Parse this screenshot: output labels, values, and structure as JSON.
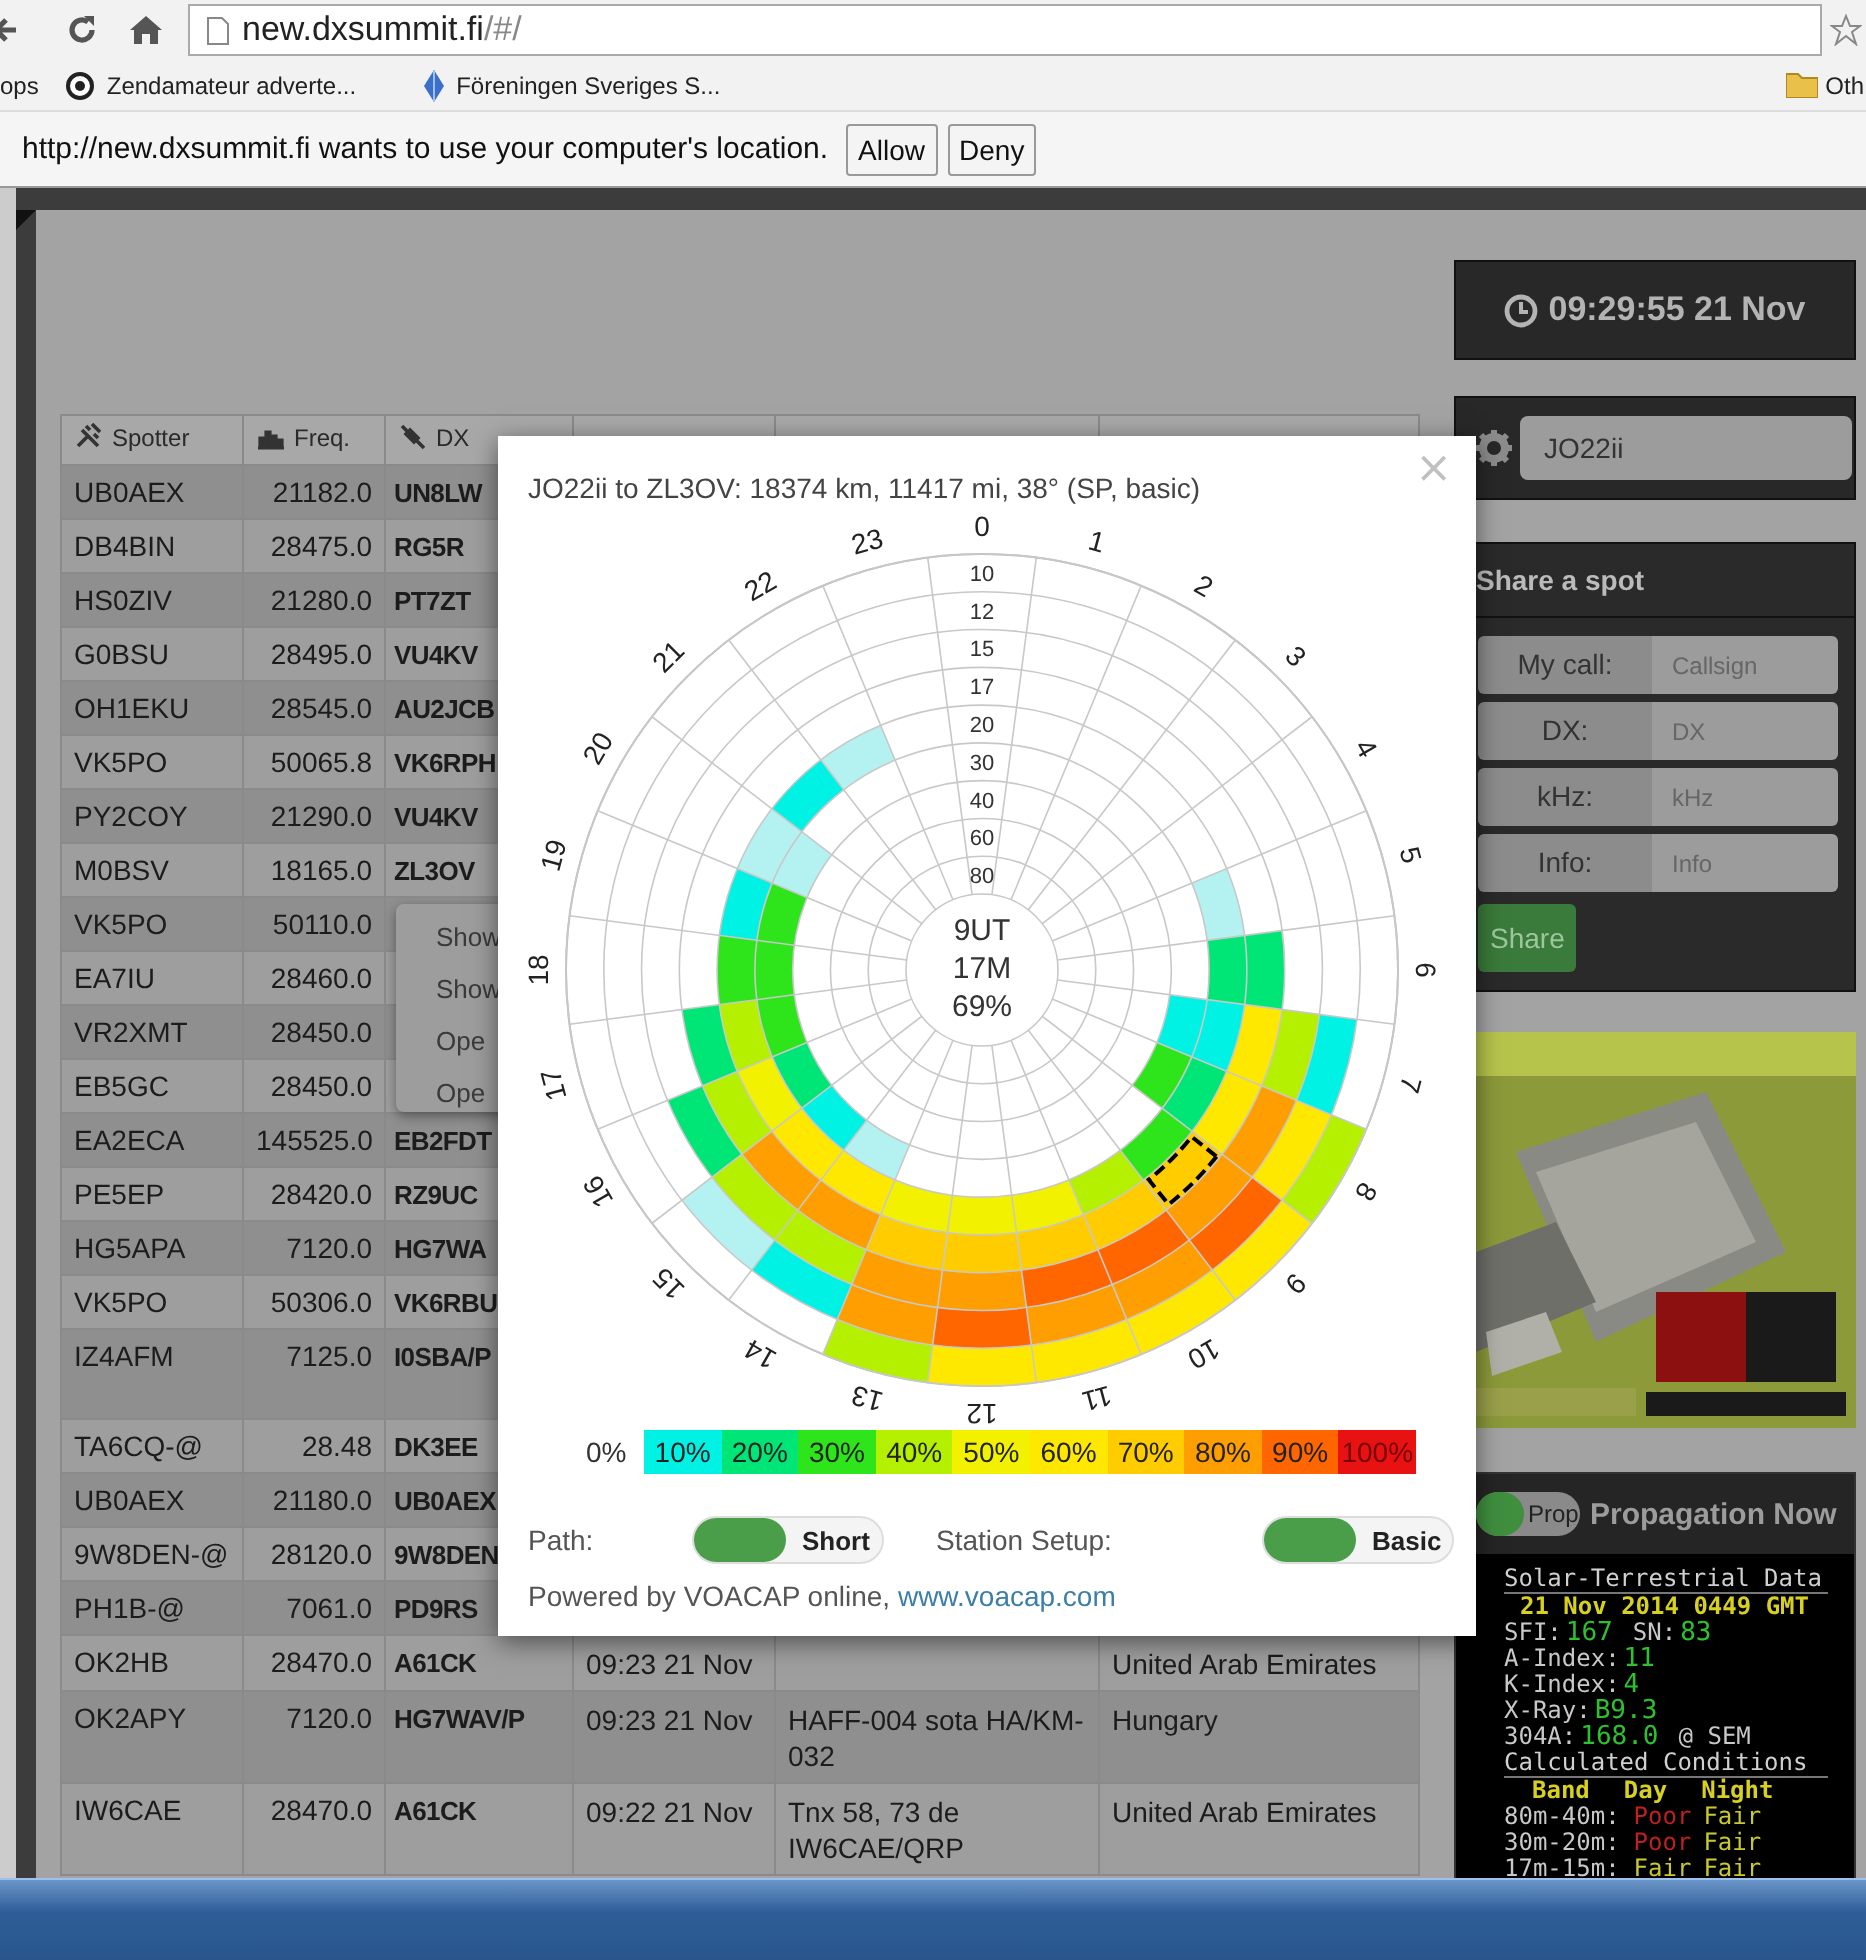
{
  "browser": {
    "url_host": "new.dxsummit.fi",
    "url_path": "/#/"
  },
  "bookmarks": [
    {
      "label": "ops",
      "kind": "apps"
    },
    {
      "label": "Zendamateur adverte...",
      "kind": "circle"
    },
    {
      "label": "Föreningen Sveriges S...",
      "kind": "diamond"
    },
    {
      "label": "Oth",
      "kind": "folder"
    }
  ],
  "infobar": {
    "message": "http://new.dxsummit.fi wants to use your computer's location.",
    "buttons": [
      "Allow",
      "Deny"
    ]
  },
  "table": {
    "columns": [
      {
        "label": "Spotter",
        "kind": "spotter"
      },
      {
        "label": "Freq.",
        "kind": "freq"
      },
      {
        "label": "DX",
        "kind": "dx"
      }
    ],
    "rows": [
      {
        "spotter": "UB0AEX",
        "freq": "21182.0",
        "dx": "UN8LW"
      },
      {
        "spotter": "DB4BIN",
        "freq": "28475.0",
        "dx": "RG5R"
      },
      {
        "spotter": "HS0ZIV",
        "freq": "21280.0",
        "dx": "PT7ZT"
      },
      {
        "spotter": "G0BSU",
        "freq": "28495.0",
        "dx": "VU4KV"
      },
      {
        "spotter": "OH1EKU",
        "freq": "28545.0",
        "dx": "AU2JCB"
      },
      {
        "spotter": "VK5PO",
        "freq": "50065.8",
        "dx": "VK6RPH"
      },
      {
        "spotter": "PY2COY",
        "freq": "21290.0",
        "dx": "VU4KV"
      },
      {
        "spotter": "M0BSV",
        "freq": "18165.0",
        "dx": "ZL3OV"
      },
      {
        "spotter": "VK5PO",
        "freq": "50110.0"
      },
      {
        "spotter": "EA7IU",
        "freq": "28460.0"
      },
      {
        "spotter": "VR2XMT",
        "freq": "28450.0"
      },
      {
        "spotter": "EB5GC",
        "freq": "28450.0"
      },
      {
        "spotter": "EA2ECA",
        "freq": "145525.0",
        "dx": "EB2FDT"
      },
      {
        "spotter": "PE5EP",
        "freq": "28420.0",
        "dx": "RZ9UC"
      },
      {
        "spotter": "HG5APA",
        "freq": "7120.0",
        "dx": "HG7WA"
      },
      {
        "spotter": "VK5PO",
        "freq": "50306.0",
        "dx": "VK6RBU"
      },
      {
        "spotter": "IZ4AFM",
        "freq": "7125.0",
        "dx": "I0SBA/P",
        "wrapped": true
      },
      {
        "spotter": "TA6CQ-@",
        "freq": "28.48",
        "dx": "DK3EE"
      },
      {
        "spotter": "UB0AEX",
        "freq": "21180.0",
        "dx": "UB0AEX"
      },
      {
        "spotter": "9W8DEN-@",
        "freq": "28120.0",
        "dx": "9W8DEN"
      },
      {
        "spotter": "PH1B-@",
        "freq": "7061.0",
        "dx": "PD9RS"
      },
      {
        "spotter": "OK2HB",
        "freq": "28470.0",
        "dx": "A61CK",
        "time": "09:23 21 Nov",
        "country": "United Arab Emirates"
      },
      {
        "spotter": "OK2APY",
        "freq": "7120.0",
        "dx": "HG7WAV/P",
        "time": "09:23 21 Nov",
        "info": "HAFF-004 sota HA/KM-032",
        "country": "Hungary"
      },
      {
        "spotter": "IW6CAE",
        "freq": "28470.0",
        "dx": "A61CK",
        "time": "09:22 21 Nov",
        "info": "Tnx 58, 73 de IW6CAE/QRP",
        "country": "United Arab Emirates"
      }
    ]
  },
  "context_menu": [
    "Show",
    "Show",
    "Ope",
    "Ope"
  ],
  "clock": "09:29:55 21 Nov",
  "locator": "JO22ii",
  "share": {
    "title": "Share a spot",
    "fields": [
      {
        "label": "My call:",
        "placeholder": "Callsign"
      },
      {
        "label": "DX:",
        "placeholder": "DX"
      },
      {
        "label": "kHz:",
        "placeholder": "kHz"
      },
      {
        "label": "Info:",
        "placeholder": "Info"
      }
    ],
    "button": "Share"
  },
  "ad": {
    "kind": "picture"
  },
  "propagation_now": {
    "toggle": {
      "label": "Prop",
      "on": true
    },
    "title": "Propagation Now",
    "solar": {
      "title": "Solar-Terrestrial Data",
      "date": "21 Nov 2014 0449 GMT",
      "lines": [
        [
          {
            "label": "SFI:",
            "value": "167"
          },
          {
            "label": "SN:",
            "value": "83"
          }
        ],
        [
          {
            "label": "A-Index:",
            "value": "11"
          }
        ],
        [
          {
            "label": "K-Index:",
            "value": "4"
          }
        ],
        [
          {
            "label": "X-Ray:",
            "value": "B9.3"
          }
        ],
        [
          {
            "label": "304A:",
            "value": "168.0",
            "suffix": "@ SEM"
          }
        ]
      ],
      "conditions_title": "Calculated Conditions",
      "headers": [
        "Band",
        "Day",
        "Night"
      ],
      "bands": [
        {
          "band": "80m-40m:",
          "day": {
            "text": "Poor",
            "kind": "poor"
          },
          "night": {
            "text": "Fair",
            "kind": "fair"
          }
        },
        {
          "band": "30m-20m:",
          "day": {
            "text": "Poor",
            "kind": "poor"
          },
          "night": {
            "text": "Fair",
            "kind": "fair"
          }
        },
        {
          "band": "17m-15m:",
          "day": {
            "text": "Fair",
            "kind": "fair"
          },
          "night": {
            "text": "Fair",
            "kind": "fair"
          }
        }
      ]
    }
  },
  "propagation": {
    "title": "JO22ii to ZL3OV: 18374 km, 11417 mi, 38° (SP, basic)",
    "close": "×",
    "hours": [
      "0",
      "1",
      "2",
      "3",
      "4",
      "5",
      "6",
      "7",
      "8",
      "9",
      "10",
      "11",
      "12",
      "13",
      "14",
      "15",
      "16",
      "17",
      "18",
      "19",
      "20",
      "21",
      "22",
      "23"
    ],
    "rings": [
      {
        "label": "10",
        "cells": [
          null,
          null,
          null,
          null,
          null,
          null,
          null,
          null,
          {
            "color": "#b4f000",
            "selected": false
          },
          {
            "color": "#ffe800",
            "selected": false
          },
          {
            "color": "#ffe800",
            "selected": false
          },
          {
            "color": "#ffe800",
            "selected": false
          },
          {
            "color": "#ffe800",
            "selected": false
          },
          {
            "color": "#b4f000",
            "selected": false
          },
          null,
          null,
          null,
          null,
          null,
          null,
          null,
          null,
          null,
          null
        ]
      },
      {
        "label": "12",
        "cells": [
          null,
          null,
          null,
          null,
          null,
          null,
          null,
          {
            "color": "#00f2e4",
            "selected": false
          },
          {
            "color": "#ffe800",
            "selected": false
          },
          {
            "color": "#ff6600",
            "selected": false
          },
          {
            "color": "#ff9e00",
            "selected": false
          },
          {
            "color": "#ff9e00",
            "selected": false
          },
          {
            "color": "#ff6600",
            "selected": false
          },
          {
            "color": "#ff9e00",
            "selected": false
          },
          {
            "color": "#00f2e4",
            "selected": false
          },
          {
            "color": "#b4f2f2",
            "selected": false
          },
          null,
          null,
          null,
          null,
          null,
          null,
          null,
          null
        ]
      },
      {
        "label": "15",
        "cells": [
          null,
          null,
          null,
          null,
          null,
          null,
          null,
          {
            "color": "#b4f000",
            "selected": false
          },
          {
            "color": "#ff9e00",
            "selected": false
          },
          {
            "color": "#ff9e00",
            "selected": false
          },
          {
            "color": "#ff6600",
            "selected": false
          },
          {
            "color": "#ff6600",
            "selected": false
          },
          {
            "color": "#ff9e00",
            "selected": false
          },
          {
            "color": "#ff9e00",
            "selected": false
          },
          {
            "color": "#b4f000",
            "selected": false
          },
          {
            "color": "#b4f000",
            "selected": false
          },
          {
            "color": "#00e676",
            "selected": false
          },
          null,
          null,
          null,
          null,
          null,
          null,
          null
        ]
      },
      {
        "label": "17",
        "cells": [
          null,
          null,
          null,
          null,
          null,
          null,
          {
            "color": "#00e676",
            "selected": false
          },
          {
            "color": "#ffe800",
            "selected": false
          },
          {
            "color": "#ffe800",
            "selected": false
          },
          {
            "color": "#ffcc00",
            "selected": true
          },
          {
            "color": "#ffcc00",
            "selected": false
          },
          {
            "color": "#ffcc00",
            "selected": false
          },
          {
            "color": "#ffcc00",
            "selected": false
          },
          {
            "color": "#ffcc00",
            "selected": false
          },
          {
            "color": "#ff9e00",
            "selected": false
          },
          {
            "color": "#ff9e00",
            "selected": false
          },
          {
            "color": "#b4f000",
            "selected": false
          },
          {
            "color": "#00e676",
            "selected": false
          },
          null,
          null,
          null,
          null,
          null,
          null
        ]
      },
      {
        "label": "20",
        "cells": [
          null,
          null,
          null,
          null,
          null,
          {
            "color": "#b4f2f2",
            "selected": false
          },
          {
            "color": "#00e676",
            "selected": false
          },
          {
            "color": "#00f2e4",
            "selected": false
          },
          {
            "color": "#00e676",
            "selected": false
          },
          {
            "color": "#2ee41a",
            "selected": false
          },
          {
            "color": "#b4f000",
            "selected": false
          },
          {
            "color": "#f2f200",
            "selected": false
          },
          {
            "color": "#f2f200",
            "selected": false
          },
          {
            "color": "#f2f200",
            "selected": false
          },
          {
            "color": "#ffe800",
            "selected": false
          },
          {
            "color": "#ffe800",
            "selected": false
          },
          {
            "color": "#f2f200",
            "selected": false
          },
          {
            "color": "#b4f000",
            "selected": false
          },
          {
            "color": "#2ee41a",
            "selected": false
          },
          {
            "color": "#00f2e4",
            "selected": false
          },
          {
            "color": "#b4f2f2",
            "selected": false
          },
          {
            "color": "#00f2e4",
            "selected": false
          },
          {
            "color": "#b4f2f2",
            "selected": false
          },
          null
        ]
      },
      {
        "label": "30",
        "cells": [
          null,
          null,
          null,
          null,
          null,
          null,
          null,
          {
            "color": "#00f2e4",
            "selected": false
          },
          {
            "color": "#2ee41a",
            "selected": false
          },
          null,
          null,
          null,
          null,
          null,
          {
            "color": "#b4f2f2",
            "selected": false
          },
          {
            "color": "#00f2e4",
            "selected": false
          },
          {
            "color": "#00e676",
            "selected": false
          },
          {
            "color": "#2ee41a",
            "selected": false
          },
          {
            "color": "#2ee41a",
            "selected": false
          },
          {
            "color": "#2ee41a",
            "selected": false
          },
          {
            "color": "#b4f2f2",
            "selected": false
          },
          null,
          null,
          null
        ]
      },
      {
        "label": "40"
      },
      {
        "label": "60"
      },
      {
        "label": "80"
      }
    ],
    "center": [
      "9UT",
      "17M",
      "69%"
    ],
    "legend": [
      {
        "label": "0%"
      },
      {
        "label": "10%",
        "color": "#00f2e4"
      },
      {
        "label": "20%",
        "color": "#00e676"
      },
      {
        "label": "30%",
        "color": "#2ee41a"
      },
      {
        "label": "40%",
        "color": "#b4f000"
      },
      {
        "label": "50%",
        "color": "#f2f200"
      },
      {
        "label": "60%",
        "color": "#ffe800"
      },
      {
        "label": "70%",
        "color": "#ffcc00"
      },
      {
        "label": "80%",
        "color": "#ff9e00"
      },
      {
        "label": "90%",
        "color": "#ff6600"
      },
      {
        "label": "100%",
        "color": "#e81212"
      }
    ],
    "toggles": [
      {
        "label": "Path:",
        "value": "Short",
        "on": true
      },
      {
        "label": "Station Setup:",
        "value": "Basic",
        "on": true
      }
    ],
    "footer": "Powered by VOACAP online, ",
    "link": "www.voacap.com"
  }
}
